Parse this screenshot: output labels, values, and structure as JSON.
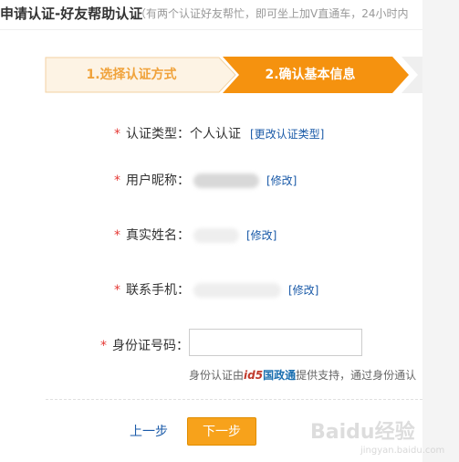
{
  "header": {
    "title": "申请认证-好友帮助认证",
    "subtitle": "（有两个认证好友帮忙，即可坐上加V直通车，24小时内"
  },
  "steps": [
    {
      "label": "1.选择认证方式"
    },
    {
      "label": "2.确认基本信息"
    }
  ],
  "form": {
    "cert_type": {
      "label": "认证类型：",
      "value": "个人认证",
      "action": "[更改认证类型]"
    },
    "nickname": {
      "label": "用户昵称：",
      "action": "[修改]"
    },
    "real_name": {
      "label": "真实姓名：",
      "action": "[修改]"
    },
    "phone": {
      "label": "联系手机：",
      "action": "[修改]"
    },
    "id_number": {
      "label": "身份证号码：",
      "value": ""
    },
    "hint": {
      "prefix": "身份认证由",
      "brand_a": "id5",
      "brand_b": "国政通",
      "suffix": "提供支持，通过身份通认"
    }
  },
  "actions": {
    "prev": "上一步",
    "next": "下一步"
  },
  "watermark": {
    "text": "Baidu经验",
    "url": "jingyan.baidu.com"
  },
  "colors": {
    "accent": "#f7a21b",
    "link": "#1a5aa8",
    "required": "#e53935"
  }
}
